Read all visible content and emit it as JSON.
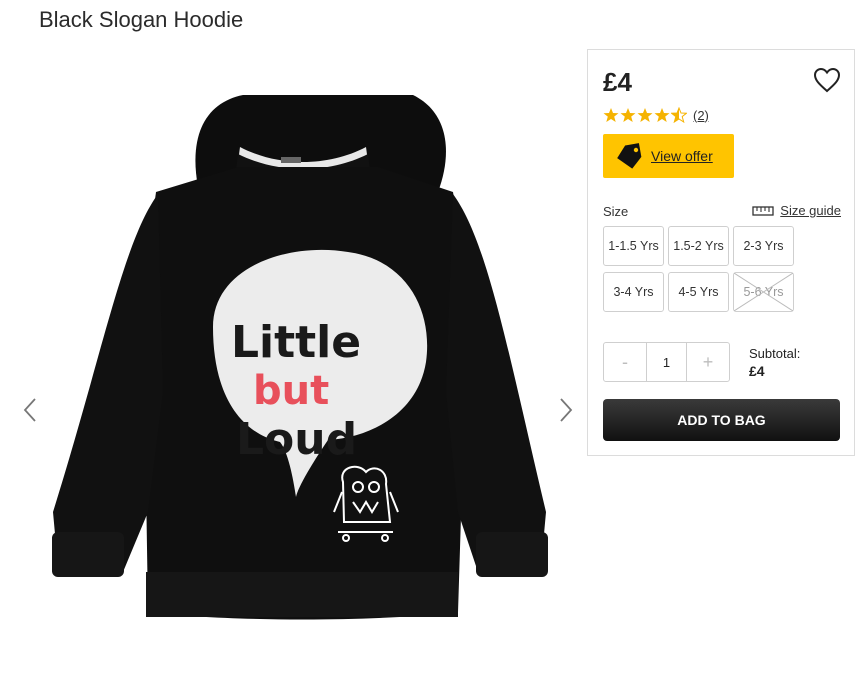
{
  "product": {
    "title": "Black Slogan Hoodie",
    "image_text": {
      "line1": "Little",
      "line2": "but",
      "line3": "Loud"
    }
  },
  "gallery": {
    "prev_icon": "chevron-left-icon",
    "next_icon": "chevron-right-icon"
  },
  "purchase": {
    "price": "£4",
    "wishlist_icon": "heart-icon",
    "rating": {
      "value": 4.5,
      "max": 5,
      "count_label": "(2)",
      "star_color": "#f5b301"
    },
    "offer": {
      "label": "View offer",
      "icon": "tag-icon",
      "color": "#ffc400"
    },
    "size": {
      "label": "Size",
      "guide_label": "Size guide",
      "guide_icon": "ruler-icon",
      "options": [
        {
          "label": "1-1.5 Yrs",
          "available": true
        },
        {
          "label": "1.5-2 Yrs",
          "available": true
        },
        {
          "label": "2-3 Yrs",
          "available": true
        },
        {
          "label": "3-4 Yrs",
          "available": true
        },
        {
          "label": "4-5 Yrs",
          "available": true
        },
        {
          "label": "5-6 Yrs",
          "available": false
        }
      ]
    },
    "quantity": {
      "minus": "-",
      "value": "1",
      "plus": "+"
    },
    "subtotal": {
      "label": "Subtotal:",
      "value": "£4"
    },
    "add_to_bag": "ADD TO BAG"
  }
}
